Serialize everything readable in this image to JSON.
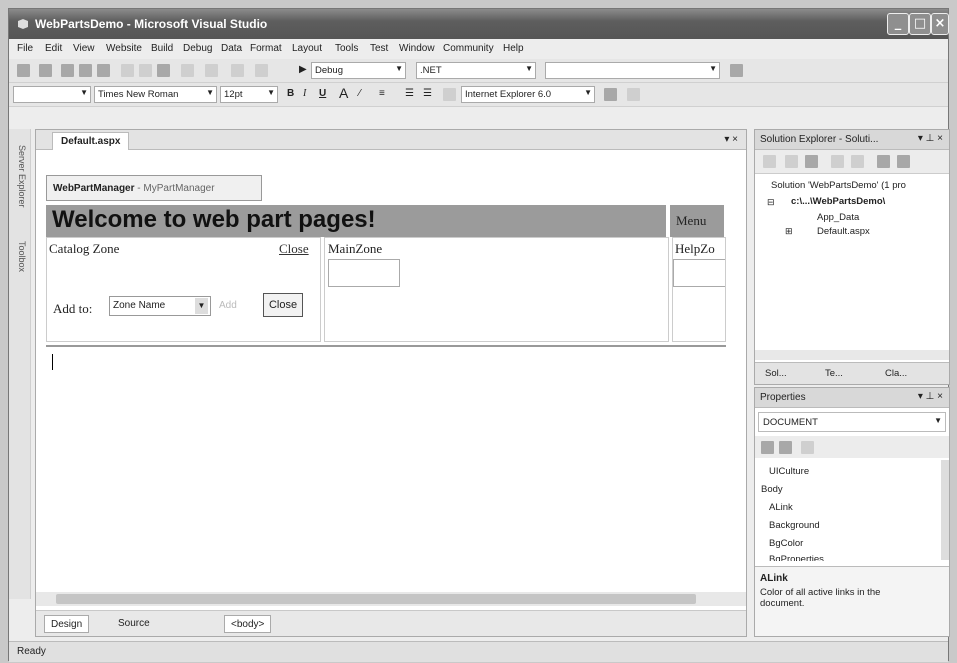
{
  "window": {
    "title": "WebPartsDemo - Microsoft Visual Studio"
  },
  "menubar": [
    "File",
    "Edit",
    "View",
    "Website",
    "Build",
    "Debug",
    "Data",
    "Format",
    "Layout",
    "Tools",
    "Test",
    "Window",
    "Community",
    "Help"
  ],
  "toolbar1": {
    "config_value": "Debug",
    "platform_value": ".NET"
  },
  "toolbar2": {
    "font_value": "Times New Roman",
    "size_value": "12pt",
    "target_value": "Internet Explorer 6.0"
  },
  "side_tabs": {
    "solution": "Server Explorer",
    "toolbox": "Toolbox"
  },
  "doc": {
    "tab_label": "Default.aspx",
    "close_glyph": "▾ ×",
    "wpm_prefix": "WebPartManager",
    "wpm_sep": " - ",
    "wpm_name": "MyPartManager",
    "welcome_text": "Welcome to web part pages!",
    "menu_text": "Menu",
    "catalog_zone": "Catalog Zone",
    "close_link": "Close",
    "main_zone": "MainZone",
    "help_zone": "HelpZo",
    "add_to_label": "Add to:",
    "zone_select_value": "Zone Name",
    "close_button": "Close"
  },
  "bottom": {
    "design_tab": "Design",
    "source_tab": "Source",
    "tag": "<body>"
  },
  "solution_explorer": {
    "title": "Solution Explorer - Soluti...",
    "solution_node": "Solution 'WebPartsDemo' (1 pro",
    "project_node": "c:\\...\\WebPartsDemo\\",
    "app_data": "App_Data",
    "default_aspx": "Default.aspx",
    "tabs": [
      "Sol...",
      "Te...",
      "Cla..."
    ]
  },
  "properties": {
    "title": "Properties",
    "object": "DOCUMENT",
    "rows": [
      "UICulture",
      "Body",
      "ALink",
      "Background",
      "BgColor",
      "BgProperties"
    ],
    "desc_title": "ALink",
    "desc_text": "Color of all active links in the document."
  },
  "status": {
    "text": "Ready"
  }
}
